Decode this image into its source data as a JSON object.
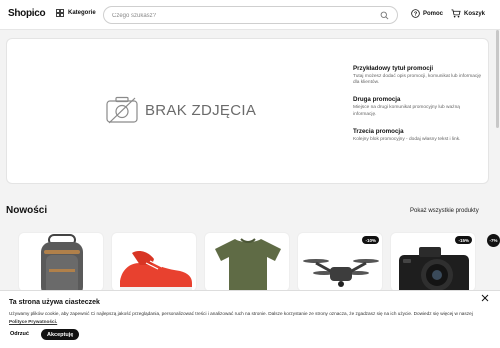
{
  "header": {
    "logo": "Shopico",
    "categories_label": "Kategorie",
    "search_placeholder": "Czego szukasz?",
    "help_label": "Pomoc",
    "cart_label": "Koszyk"
  },
  "hero": {
    "no_photo_text": "BRAK ZDJĘCIA",
    "promos": [
      {
        "title": "Przykładowy tytuł promocji",
        "desc": "Tutaj możesz dodać opis promocji, komunikat lub informację dla klientów."
      },
      {
        "title": "Druga promocja",
        "desc": "Miejsce na drugi komunikat promocyjny lub ważną informację."
      },
      {
        "title": "Trzecia promocja",
        "desc": "Kolejny blok promocyjny - dodaj własny tekst i link."
      }
    ]
  },
  "new_section": {
    "title": "Nowości",
    "show_all": "Pokaż wszystkie produkty",
    "products": [
      {
        "name": "backpack",
        "badge": ""
      },
      {
        "name": "sneakers",
        "badge": ""
      },
      {
        "name": "t-shirt",
        "badge": ""
      },
      {
        "name": "drone",
        "badge": "-10%"
      },
      {
        "name": "camera",
        "badge": "-15%"
      }
    ],
    "next_badge": "-7%"
  },
  "cookie": {
    "title": "Ta strona używa ciasteczek",
    "text": "Używamy plików cookie, aby zapewnić Ci najlepszą jakość przeglądania, personalizować treści i analizować ruch na stronie. Dalsze korzystanie ze strony oznacza, że zgadzasz się na ich użycie. Dowiedz się więcej w naszej",
    "policy_link": "Polityce Prywatności.",
    "reject_label": "Odrzuć",
    "accept_label": "Akceptuję"
  },
  "colors": {
    "primary": "#111111",
    "background": "#f3f3f3",
    "surface": "#ffffff",
    "muted_text": "#6b6b6b"
  }
}
